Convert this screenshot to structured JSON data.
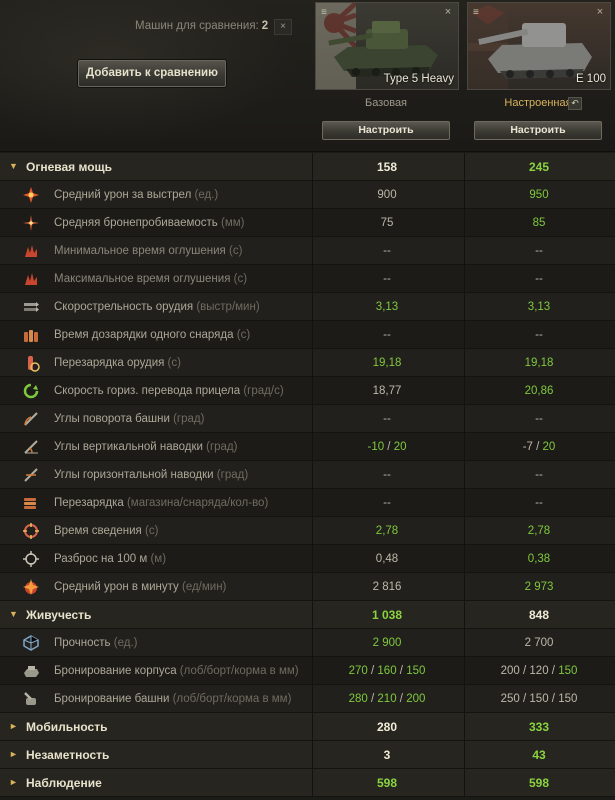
{
  "header": {
    "compare_label": "Машин для сравнения:",
    "compare_count": "2",
    "clear_symbol": "×",
    "add_button": "Добавить к сравнению"
  },
  "tanks": [
    {
      "name": "Type 5 Heavy",
      "config": "Базовая",
      "setup_button": "Настроить",
      "card_icon": "≡",
      "close_symbol": "×"
    },
    {
      "name": "E 100",
      "config": "Настроенная",
      "setup_button": "Настроить",
      "card_icon": "≡",
      "close_symbol": "×",
      "undo_symbol": "↶"
    }
  ],
  "colors": {
    "better": "#7fc93d",
    "accent": "#d9b25a",
    "text": "#bdb8a8"
  },
  "rows": {
    "firepower": {
      "label": "Огневая мощь",
      "v1": "158",
      "v2": "245"
    },
    "avg_damage": {
      "label": "Средний урон за выстрел",
      "unit": "(ед.)",
      "icon": "damage-icon",
      "v1": "900",
      "v2": "950"
    },
    "penetration": {
      "label": "Средняя бронепробиваемость",
      "unit": "(мм)",
      "icon": "penetration-icon",
      "v1": "75",
      "v2": "85"
    },
    "min_stun": {
      "label": "Минимальное время оглушения",
      "unit": "(с)",
      "icon": "stun-icon",
      "v1": "--",
      "v2": "--"
    },
    "max_stun": {
      "label": "Максимальное время оглушения",
      "unit": "(с)",
      "icon": "stun-icon",
      "v1": "--",
      "v2": "--"
    },
    "rate_of_fire": {
      "label": "Скорострельность орудия",
      "unit": "(выстр/мин)",
      "icon": "rate-of-fire-icon",
      "v1": "3,13",
      "v2": "3,13"
    },
    "shell_reload": {
      "label": "Время дозарядки одного снаряда",
      "unit": "(с)",
      "icon": "shell-reload-icon",
      "v1": "--",
      "v2": "--"
    },
    "reload": {
      "label": "Перезарядка орудия",
      "unit": "(с)",
      "icon": "reload-icon",
      "v1": "19,18",
      "v2": "19,18"
    },
    "traverse": {
      "label": "Скорость гориз. перевода прицела",
      "unit": "(град/с)",
      "icon": "traverse-icon",
      "v1": "18,77",
      "v2": "20,86"
    },
    "turret_angles": {
      "label": "Углы поворота башни",
      "unit": "(град)",
      "icon": "turret-angle-icon",
      "v1": "--",
      "v2": "--"
    },
    "vertical_angles": {
      "label": "Углы вертикальной наводки",
      "unit": "(град)",
      "icon": "vertical-angle-icon",
      "v1a": "-10",
      "v1b": "20",
      "v2a": "-7",
      "v2b": "20"
    },
    "horizontal_angles": {
      "label": "Углы горизонтальной наводки",
      "unit": "(град)",
      "icon": "horizontal-angle-icon",
      "v1": "--",
      "v2": "--"
    },
    "magazine_reload": {
      "label": "Перезарядка",
      "unit": "(магазина/снаряда/кол-во)",
      "icon": "magazine-icon",
      "v1": "--",
      "v2": "--"
    },
    "aim_time": {
      "label": "Время сведения",
      "unit": "(с)",
      "icon": "aim-time-icon",
      "v1": "2,78",
      "v2": "2,78"
    },
    "dispersion": {
      "label": "Разброс на 100 м",
      "unit": "(м)",
      "icon": "dispersion-icon",
      "v1": "0,48",
      "v2": "0,38"
    },
    "dpm": {
      "label": "Средний урон в минуту",
      "unit": "(ед/мин)",
      "icon": "dpm-icon",
      "v1": "2 816",
      "v2": "2 973"
    },
    "survivability": {
      "label": "Живучесть",
      "v1": "1 038",
      "v2": "848"
    },
    "hp": {
      "label": "Прочность",
      "unit": "(ед.)",
      "icon": "hp-icon",
      "v1": "2 900",
      "v2": "2 700"
    },
    "hull_armor": {
      "label": "Бронирование корпуса",
      "unit": "(лоб/борт/корма в мм)",
      "icon": "hull-armor-icon",
      "v1a": "270",
      "v1b": "160",
      "v1c": "150",
      "v2a": "200",
      "v2b": "120",
      "v2c": "150"
    },
    "turret_armor": {
      "label": "Бронирование башни",
      "unit": "(лоб/борт/корма в мм)",
      "icon": "turret-armor-icon",
      "v1a": "280",
      "v1b": "210",
      "v1c": "200",
      "v2a": "250",
      "v2b": "150",
      "v2c": "150"
    },
    "mobility": {
      "label": "Мобильность",
      "v1": "280",
      "v2": "333"
    },
    "concealment": {
      "label": "Незаметность",
      "v1": "3",
      "v2": "43"
    },
    "spotting": {
      "label": "Наблюдение",
      "v1": "598",
      "v2": "598"
    }
  }
}
